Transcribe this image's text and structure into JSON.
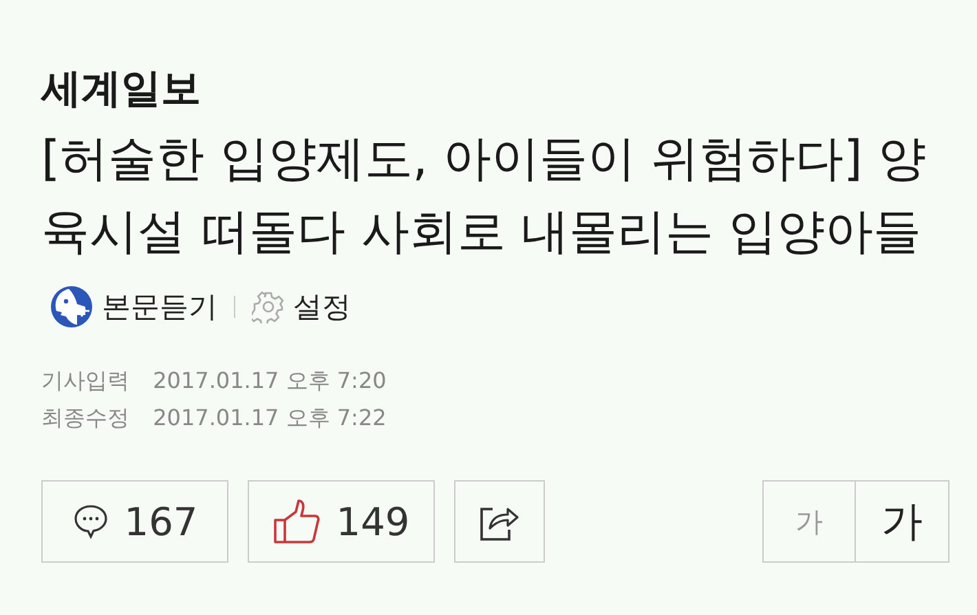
{
  "source": "세계일보",
  "headline": "[허술한 입양제도, 아이들이 위험하다] 양육시설 떠돌다 사회로 내몰리는 입양아들",
  "listen": {
    "label": "본문듣기"
  },
  "settings": {
    "label": "설정"
  },
  "dates": [
    {
      "label": "기사입력",
      "value": "2017.01.17 오후 7:20"
    },
    {
      "label": "최종수정",
      "value": "2017.01.17 오후 7:22"
    }
  ],
  "comments": {
    "count": "167"
  },
  "likes": {
    "count": "149"
  },
  "font_sizes": [
    {
      "label": "가",
      "kind": "small",
      "selected": false
    },
    {
      "label": "가",
      "kind": "large",
      "selected": true
    }
  ]
}
